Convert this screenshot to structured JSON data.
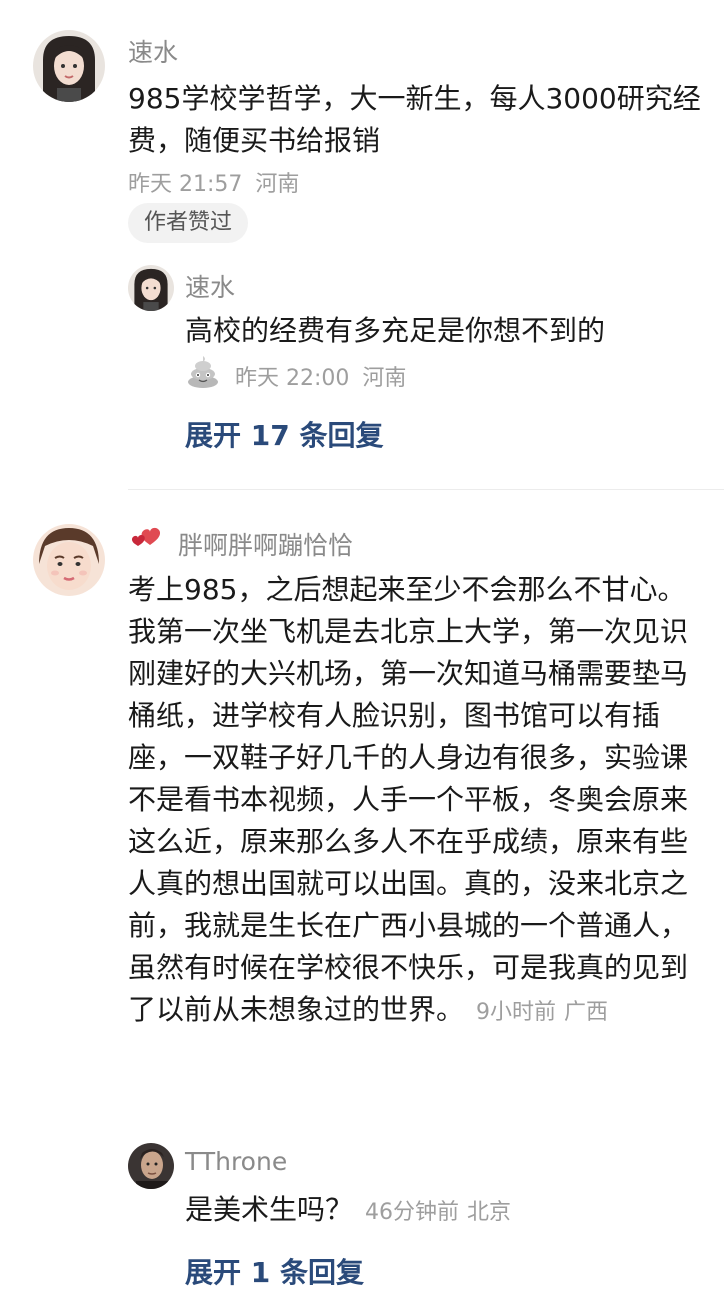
{
  "comments": [
    {
      "username": "速水",
      "content": "985学校学哲学，大一新生，每人3000研究经费，随便买书给报销",
      "time": "昨天 21:57",
      "location": "河南",
      "badge": "作者赞过",
      "reply": {
        "username": "速水",
        "content": "高校的经费有多充足是你想不到的",
        "time": "昨天 22:00",
        "location": "河南"
      },
      "expand_label": "展开 17 条回复"
    },
    {
      "username": "胖啊胖啊蹦恰恰",
      "content": "考上985，之后想起来至少不会那么不甘心。我第一次坐飞机是去北京上大学，第一次见识刚建好的大兴机场，第一次知道马桶需要垫马桶纸，进学校有人脸识别，图书馆可以有插座，一双鞋子好几千的人身边有很多，实验课不是看书本视频，人手一个平板，冬奥会原来这么近，原来那么多人不在乎成绩，原来有些人真的想出国就可以出国。真的，没来北京之前，我就是生长在广西小县城的一个普通人，虽然有时候在学校很不快乐，可是我真的见到了以前从未想象过的世界。",
      "time": "9小时前",
      "location": "广西",
      "reply": {
        "username": "TThrone",
        "content": "是美术生吗？",
        "time": "46分钟前",
        "location": "北京"
      },
      "expand_label": "展开 1 条回复"
    }
  ],
  "colors": {
    "expand": "#2a4a7a",
    "meta": "#9e9e9e",
    "username": "#8a8a8a"
  },
  "icons": {
    "username_badge": "heart-icon",
    "reply_emoji": "poop-emoji-icon"
  }
}
